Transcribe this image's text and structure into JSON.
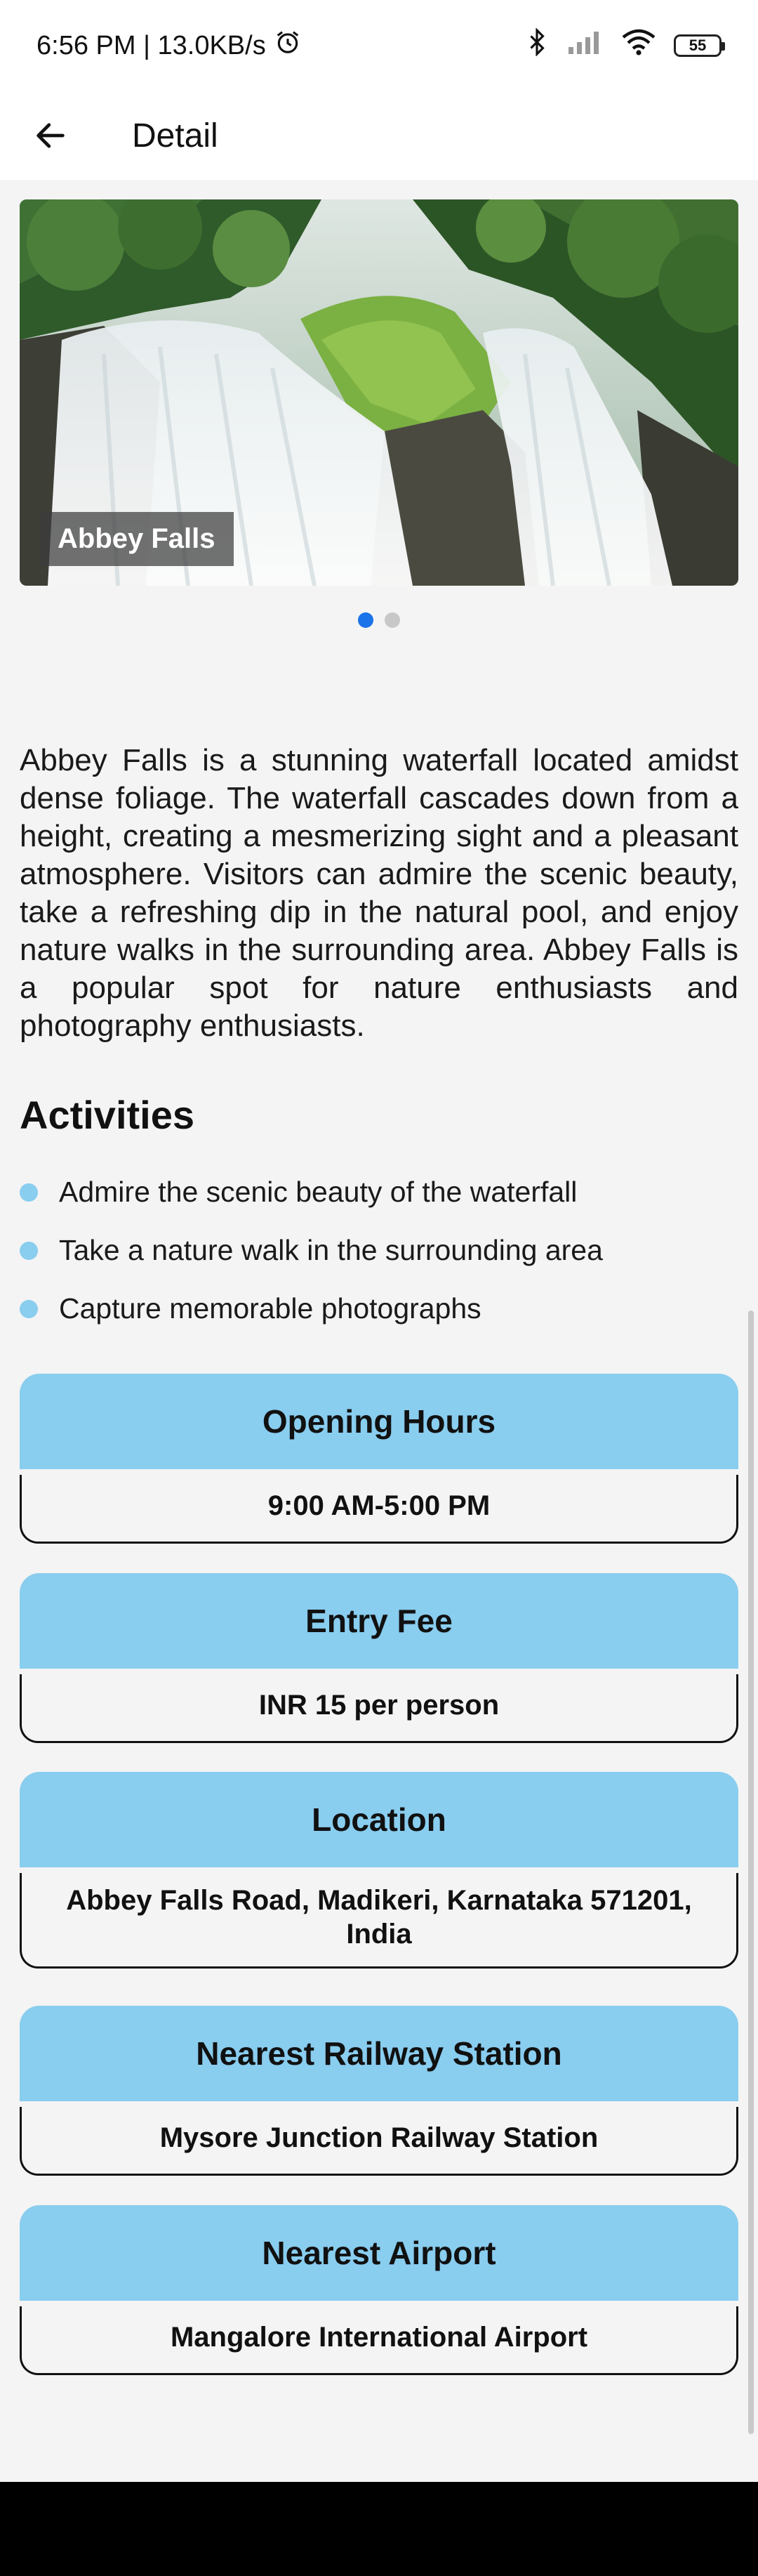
{
  "status_bar": {
    "time_info": "6:56 PM | 13.0KB/s",
    "battery": "55"
  },
  "app_bar": {
    "title": "Detail"
  },
  "hero": {
    "caption": "Abbey Falls",
    "page_indicator": {
      "count": 2,
      "active_index": 0
    }
  },
  "description": "Abbey Falls is a stunning waterfall located amidst dense foliage. The waterfall cascades down from a height, creating a mesmerizing sight and a pleasant atmosphere. Visitors can admire the scenic beauty, take a refreshing dip in the natural pool, and enjoy nature walks in the surrounding area. Abbey Falls is a popular spot for nature enthusiasts and photography enthusiasts.",
  "activities": {
    "title": "Activities",
    "items": [
      "Admire the scenic beauty of the waterfall",
      "Take a nature walk in the surrounding area",
      "Capture memorable photographs"
    ]
  },
  "info_cards": [
    {
      "title": "Opening Hours",
      "value": "9:00 AM-5:00 PM"
    },
    {
      "title": "Entry Fee",
      "value": "INR 15 per person"
    },
    {
      "title": "Location",
      "value": "Abbey Falls Road, Madikeri, Karnataka 571201, India"
    },
    {
      "title": "Nearest Railway Station",
      "value": "Mysore Junction Railway Station"
    },
    {
      "title": "Nearest Airport",
      "value": "Mangalore International Airport"
    }
  ],
  "colors": {
    "accent_light_blue": "#89cdef",
    "active_dot": "#1a73e8",
    "background": "#f4f4f4"
  }
}
